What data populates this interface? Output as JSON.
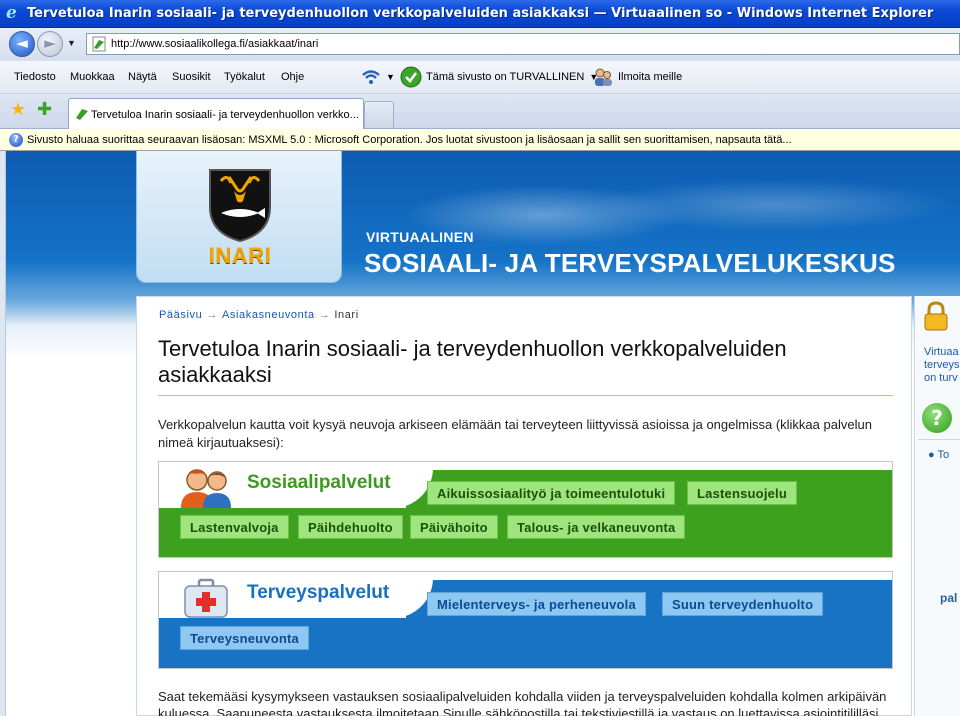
{
  "window": {
    "title": "Tervetuloa Inarin sosiaali- ja terveydenhuollon verkkopalveluiden asiakkaksi — Virtuaalinen so - Windows Internet Explorer"
  },
  "browser": {
    "url": "http://www.sosiaalikollega.fi/asiakkaat/inari",
    "menu": [
      "Tiedosto",
      "Muokkaa",
      "Näytä",
      "Suosikit",
      "Työkalut",
      "Ohje"
    ],
    "safe_site": "Tämä sivusto on TURVALLINEN",
    "report": "Ilmoita meille",
    "tab_label": "Tervetuloa Inarin sosiaali- ja terveydenhuollon verkko...",
    "infobar": "Sivusto haluaa suorittaa seuraavan lisäosan: MSXML 5.0 : Microsoft Corporation. Jos luotat sivustoon ja lisäosaan ja sallit sen suorittamisen, napsauta tätä..."
  },
  "site": {
    "town": "INARI",
    "header_sub": "VIRTUAALINEN",
    "header_main": "SOSIAALI- JA TERVEYSPALVELUKESKUS"
  },
  "breadcrumb": {
    "home": "Pääsivu",
    "sep": "→",
    "advice": "Asiakasneuvonta",
    "current": "Inari"
  },
  "page": {
    "title": "Tervetuloa Inarin sosiaali- ja terveydenhuollon verkkopalveluiden asiakkaaksi",
    "intro": "Verkkopalvelun kautta voit kysyä neuvoja arkiseen elämään tai terveyteen liittyvissä asioissa ja ongelmissa (klikkaa palvelun nimeä kirjautuaksesi):",
    "footer": "Saat tekemääsi kysymykseen vastauksen sosiaalipalveluiden kohdalla viiden ja terveyspalveluiden kohdalla kolmen arkipäivän kuluessa. Saapuneesta vastauksesta ilmoitetaan Sinulle sähköpostilla tai tekstiviestillä ja vastaus on luettavissa asiointitililläsi."
  },
  "social": {
    "title": "Sosiaalipalvelut",
    "services": [
      "Aikuissosiaalityö ja toimeentulotuki",
      "Lastensuojelu",
      "Lastenvalvoja",
      "Päihdehuolto",
      "Päivähoito",
      "Talous- ja velkaneuvonta"
    ]
  },
  "health": {
    "title": "Terveyspalvelut",
    "services": [
      "Mielenterveys- ja perheneuvola",
      "Suun terveydenhuolto",
      "Terveysneuvonta"
    ]
  },
  "sidebar": {
    "text_1": "Virtuaa",
    "text_2": "terveys",
    "text_3": "on turv",
    "link": "To",
    "bottom": "pal"
  },
  "colors": {
    "titlebar": "#0a49d6",
    "social_green": "#3ea01f",
    "health_blue": "#1973c4",
    "town_gold": "#f2a400"
  }
}
